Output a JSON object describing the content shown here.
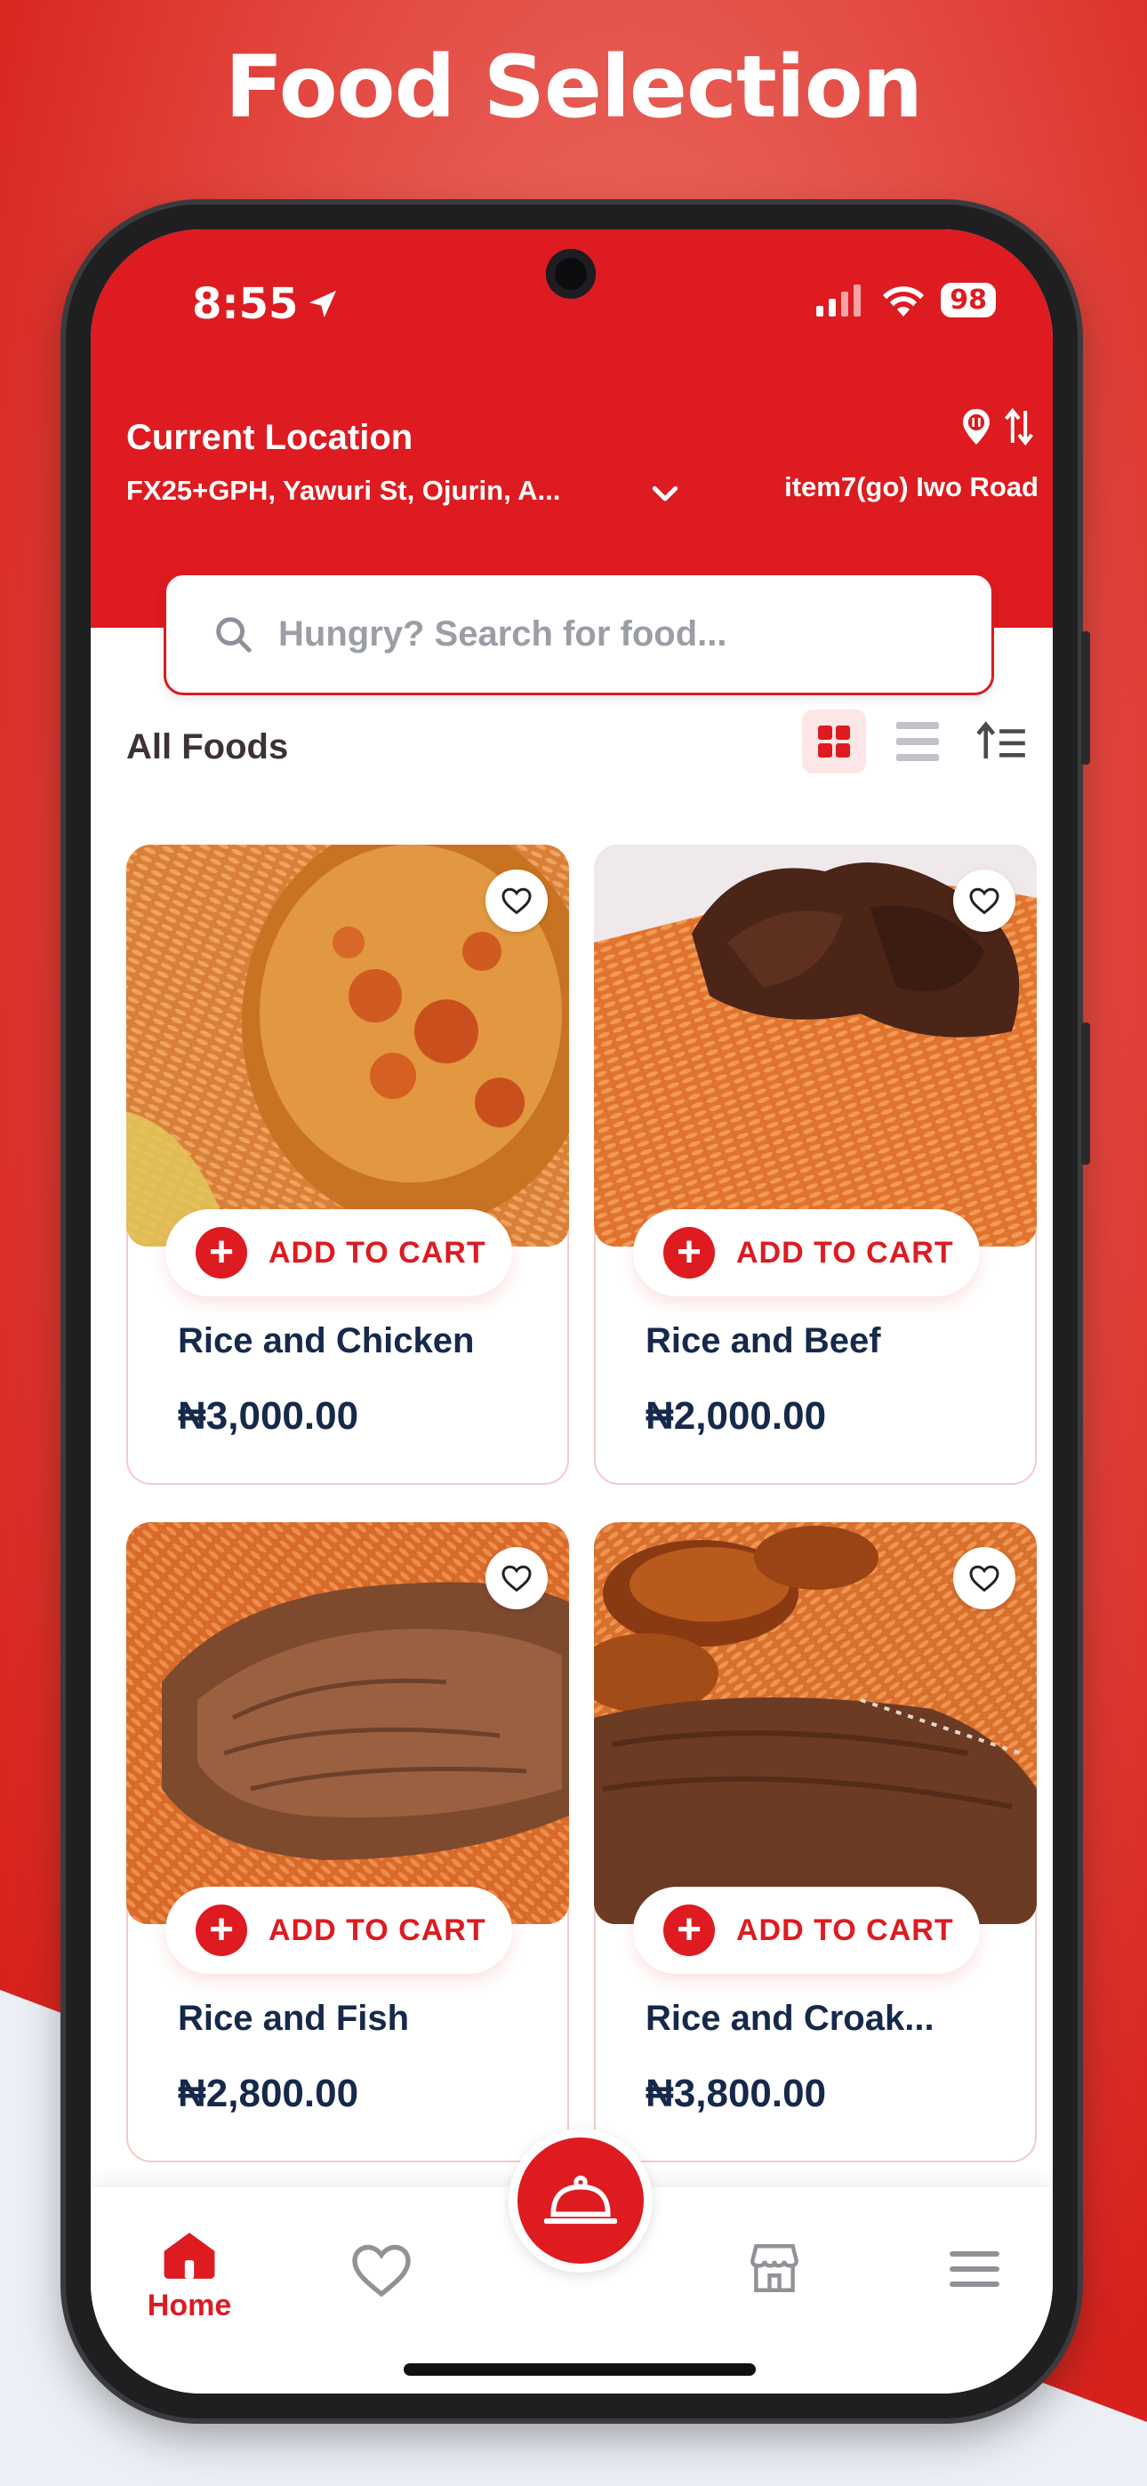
{
  "headline": "Food Selection",
  "status": {
    "time": "8:55",
    "battery": "98"
  },
  "location": {
    "title": "Current Location",
    "address": "FX25+GPH, Yawuri St, Ojurin, A...",
    "branch": "item7(go) Iwo Road"
  },
  "search": {
    "placeholder": "Hungry? Search for food..."
  },
  "section": {
    "title": "All Foods"
  },
  "foods": [
    {
      "name": "Rice and Chicken",
      "price": "₦3,000.00",
      "add_label": "ADD TO CART"
    },
    {
      "name": "Rice and Beef",
      "price": "₦2,000.00",
      "add_label": "ADD TO CART"
    },
    {
      "name": "Rice and Fish",
      "price": "₦2,800.00",
      "add_label": "ADD TO CART"
    },
    {
      "name": "Rice and Croak...",
      "price": "₦3,800.00",
      "add_label": "ADD TO CART"
    }
  ],
  "nav": {
    "home_label": "Home"
  },
  "colors": {
    "brand_red": "#dd1b20",
    "text_navy": "#16294a"
  }
}
